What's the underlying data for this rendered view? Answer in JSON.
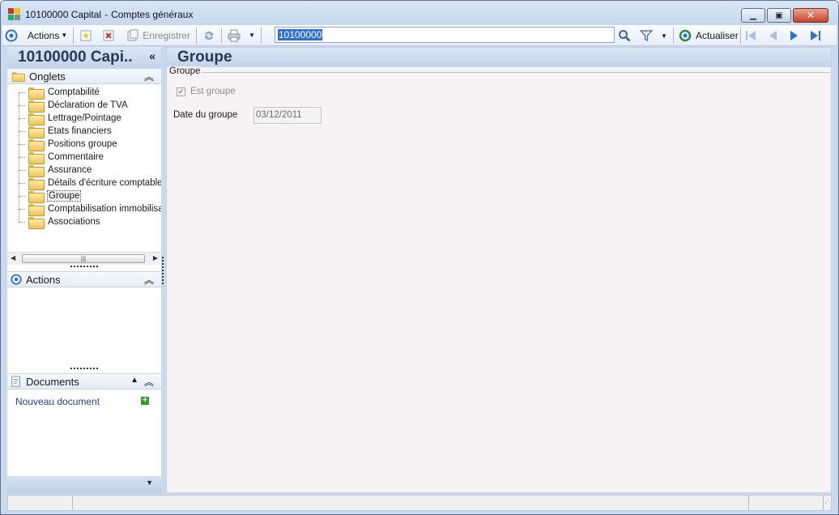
{
  "window": {
    "title_record": "10100000 Capital",
    "title_separator": "-",
    "title_module": "Comptes généraux",
    "minimize_icon": "minimize-icon",
    "maximize_icon": "restore-icon",
    "close_icon": "close-icon"
  },
  "toolbar": {
    "actions_label": "Actions",
    "save_label": "Enregistrer",
    "search_value": "10100000",
    "refresh_label": "Actualiser"
  },
  "left_panel": {
    "record_title": "10100000 Capi..",
    "collapse_glyph": "«",
    "tabs_section_label": "Onglets",
    "tabs": [
      {
        "label": "Comptabilité"
      },
      {
        "label": "Déclaration de TVA"
      },
      {
        "label": "Lettrage/Pointage"
      },
      {
        "label": "Etats financiers"
      },
      {
        "label": "Positions groupe"
      },
      {
        "label": "Commentaire"
      },
      {
        "label": "Assurance"
      },
      {
        "label": "Détails d'écriture comptable"
      },
      {
        "label": "Groupe"
      },
      {
        "label": "Comptabilisation immobilisations"
      },
      {
        "label": "Associations"
      }
    ],
    "selected_tab": "Groupe",
    "actions_section_label": "Actions",
    "documents_section_label": "Documents",
    "new_document_label": "Nouveau document"
  },
  "main": {
    "page_title": "Groupe",
    "group_legend": "Groupe",
    "is_group_label": "Est groupe",
    "is_group_checked": true,
    "group_date_label": "Date du groupe",
    "group_date_value": "03/12/2011"
  },
  "colors": {
    "accent": "#2f6fcf",
    "header_text": "#2a3a55",
    "link": "#1f3fa0",
    "main_bg": "#f7f2f6"
  }
}
